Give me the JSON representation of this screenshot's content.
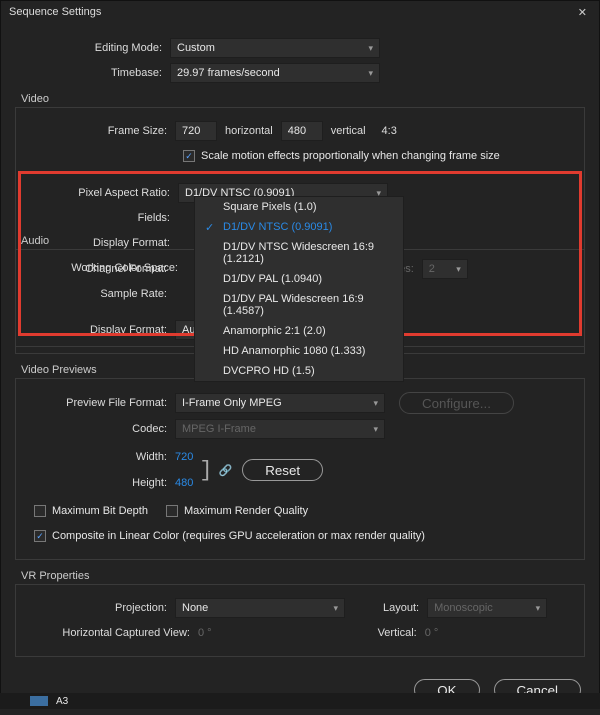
{
  "title": "Sequence Settings",
  "top": {
    "editing_mode_label": "Editing Mode:",
    "editing_mode_value": "Custom",
    "timebase_label": "Timebase:",
    "timebase_value": "29.97 frames/second"
  },
  "video": {
    "heading": "Video",
    "frame_size_label": "Frame Size:",
    "frame_w": "720",
    "horizontal": "horizontal",
    "frame_h": "480",
    "vertical": "vertical",
    "aspect": "4:3",
    "scale_checkbox": "Scale motion effects proportionally when changing frame size",
    "par_label": "Pixel Aspect Ratio:",
    "par_value": "D1/DV NTSC (0.9091)",
    "par_options": [
      "Square Pixels (1.0)",
      "D1/DV NTSC (0.9091)",
      "D1/DV NTSC Widescreen 16:9 (1.2121)",
      "D1/DV PAL (1.0940)",
      "D1/DV PAL Widescreen 16:9 (1.4587)",
      "Anamorphic 2:1 (2.0)",
      "HD Anamorphic 1080 (1.333)",
      "DVCPRO HD (1.5)"
    ],
    "fields_label": "Fields:",
    "display_format_label": "Display Format:",
    "working_color_space_label": "Working Color Space:"
  },
  "audio": {
    "heading": "Audio",
    "channel_format_label": "Channel Format:",
    "nes_label": "nes:",
    "nes_value": "2",
    "sample_rate_label": "Sample Rate:",
    "display_format_label": "Display Format:",
    "display_format_value": "Audio Samples"
  },
  "previews": {
    "heading": "Video Previews",
    "pff_label": "Preview File Format:",
    "pff_value": "I-Frame Only MPEG",
    "configure": "Configure...",
    "codec_label": "Codec:",
    "codec_value": "MPEG I-Frame",
    "width_label": "Width:",
    "width_value": "720",
    "height_label": "Height:",
    "height_value": "480",
    "reset": "Reset",
    "max_bit_depth": "Maximum Bit Depth",
    "max_render_quality": "Maximum Render Quality",
    "composite": "Composite in Linear Color (requires GPU acceleration or max render quality)"
  },
  "vr": {
    "heading": "VR Properties",
    "projection_label": "Projection:",
    "projection_value": "None",
    "layout_label": "Layout:",
    "layout_value": "Monoscopic",
    "hcv_label": "Horizontal Captured View:",
    "hcv_value": "0 °",
    "vertical_label": "Vertical:",
    "vertical_value": "0 °"
  },
  "buttons": {
    "ok": "OK",
    "cancel": "Cancel"
  },
  "strip": {
    "a3": "A3"
  }
}
